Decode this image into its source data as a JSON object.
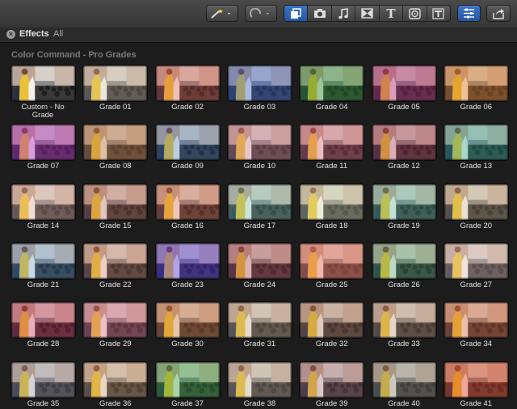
{
  "toolbar": {
    "buttons": [
      {
        "name": "magic-wand-menu-button",
        "icon": "magic-wand-icon"
      },
      {
        "name": "retime-menu-button",
        "icon": "retime-icon"
      },
      {
        "name": "effects-browser-button",
        "icon": "effects-icon",
        "active": true
      },
      {
        "name": "photos-browser-button",
        "icon": "camera-icon"
      },
      {
        "name": "music-browser-button",
        "icon": "music-note-icon"
      },
      {
        "name": "transitions-browser-button",
        "icon": "transitions-icon"
      },
      {
        "name": "titles-browser-button",
        "icon": "titles-icon",
        "glyph": "T"
      },
      {
        "name": "generators-browser-button",
        "icon": "generators-icon"
      },
      {
        "name": "themes-browser-button",
        "icon": "themes-icon"
      },
      {
        "name": "inspector-button",
        "icon": "inspector-icon",
        "active": true
      },
      {
        "name": "share-button",
        "icon": "share-icon"
      }
    ]
  },
  "panel": {
    "close_glyph": "×",
    "tab_effects": "Effects",
    "tab_all": "All"
  },
  "section_title": "Color Command - Pro Grades",
  "tiles": [
    {
      "label": "Custom - No Grade",
      "tint": "#000000",
      "alpha": 0
    },
    {
      "label": "Grade 01",
      "tint": "#d8c8a8",
      "alpha": 0.25
    },
    {
      "label": "Grade 02",
      "tint": "#e04a3a",
      "alpha": 0.3
    },
    {
      "label": "Grade 03",
      "tint": "#2f5fd0",
      "alpha": 0.38
    },
    {
      "label": "Grade 04",
      "tint": "#1f8a2a",
      "alpha": 0.4
    },
    {
      "label": "Grade 05",
      "tint": "#b02070",
      "alpha": 0.4
    },
    {
      "label": "Grade 06",
      "tint": "#e07a20",
      "alpha": 0.4
    },
    {
      "label": "Grade 07",
      "tint": "#b020c0",
      "alpha": 0.4
    },
    {
      "label": "Grade 08",
      "tint": "#c07840",
      "alpha": 0.4
    },
    {
      "label": "Grade 09",
      "tint": "#3070c0",
      "alpha": 0.28
    },
    {
      "label": "Grade 10",
      "tint": "#d07890",
      "alpha": 0.35
    },
    {
      "label": "Grade 11",
      "tint": "#e05070",
      "alpha": 0.32
    },
    {
      "label": "Grade 12",
      "tint": "#a83050",
      "alpha": 0.35
    },
    {
      "label": "Grade 13",
      "tint": "#20a090",
      "alpha": 0.35
    },
    {
      "label": "Grade 14",
      "tint": "#f0b0a0",
      "alpha": 0.3
    },
    {
      "label": "Grade 15",
      "tint": "#c06050",
      "alpha": 0.3
    },
    {
      "label": "Grade 16",
      "tint": "#e06040",
      "alpha": 0.3
    },
    {
      "label": "Grade 17",
      "tint": "#70c0b0",
      "alpha": 0.3
    },
    {
      "label": "Grade 18",
      "tint": "#d8e0b0",
      "alpha": 0.3
    },
    {
      "label": "Grade 19",
      "tint": "#50b8a0",
      "alpha": 0.3
    },
    {
      "label": "Grade 20",
      "tint": "#d0b080",
      "alpha": 0.25
    },
    {
      "label": "Grade 21",
      "tint": "#4090d8",
      "alpha": 0.25
    },
    {
      "label": "Grade 22",
      "tint": "#d07a60",
      "alpha": 0.28
    },
    {
      "label": "Grade 23",
      "tint": "#5030e0",
      "alpha": 0.4
    },
    {
      "label": "Grade 24",
      "tint": "#b04050",
      "alpha": 0.35
    },
    {
      "label": "Grade 25",
      "tint": "#f07060",
      "alpha": 0.45
    },
    {
      "label": "Grade 26",
      "tint": "#40a068",
      "alpha": 0.3
    },
    {
      "label": "Grade 27",
      "tint": "#e8c0b8",
      "alpha": 0.3
    },
    {
      "label": "Grade 28",
      "tint": "#d02050",
      "alpha": 0.32
    },
    {
      "label": "Grade 29",
      "tint": "#e06080",
      "alpha": 0.35
    },
    {
      "label": "Grade 30",
      "tint": "#d07030",
      "alpha": 0.35
    },
    {
      "label": "Grade 31",
      "tint": "#c8a888",
      "alpha": 0.3
    },
    {
      "label": "Grade 32",
      "tint": "#b07050",
      "alpha": 0.3
    },
    {
      "label": "Grade 33",
      "tint": "#c09070",
      "alpha": 0.28
    },
    {
      "label": "Grade 34",
      "tint": "#e06030",
      "alpha": 0.35
    },
    {
      "label": "Grade 35",
      "tint": "#9090a0",
      "alpha": 0.3
    },
    {
      "label": "Grade 36",
      "tint": "#d09868",
      "alpha": 0.3
    },
    {
      "label": "Grade 37",
      "tint": "#30a040",
      "alpha": 0.38
    },
    {
      "label": "Grade 38",
      "tint": "#c0a890",
      "alpha": 0.3
    },
    {
      "label": "Grade 39",
      "tint": "#a06070",
      "alpha": 0.3
    },
    {
      "label": "Grade 40",
      "tint": "#808070",
      "alpha": 0.35
    },
    {
      "label": "Grade 41",
      "tint": "#e04020",
      "alpha": 0.42
    }
  ]
}
